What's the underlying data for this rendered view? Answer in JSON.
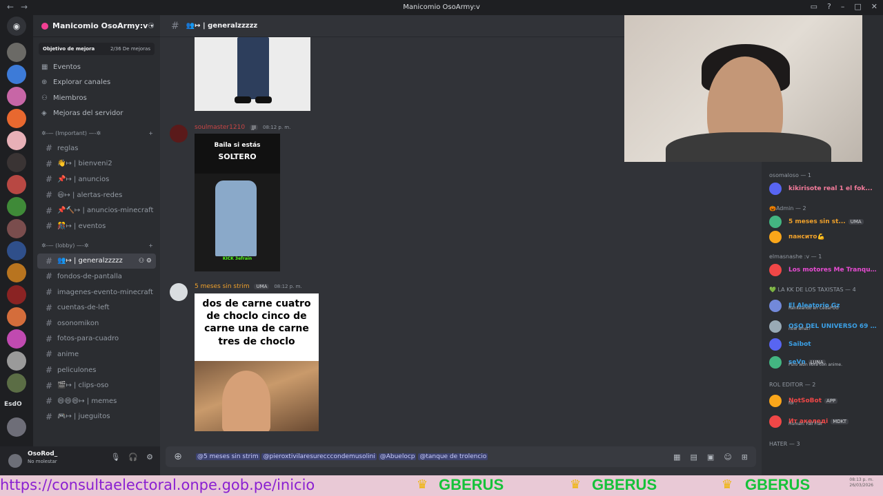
{
  "window": {
    "title": "Manicomio OsoArmy:v"
  },
  "server": {
    "name": "Manicomio OsoArmy:v",
    "boost_goal": {
      "label": "Objetivo de mejora",
      "progress": "2/36 De mejoras"
    },
    "menu": [
      {
        "label": "Eventos",
        "icon": "calendar-icon"
      },
      {
        "label": "Explorar canales",
        "icon": "compass-icon"
      },
      {
        "label": "Miembros",
        "icon": "members-icon"
      },
      {
        "label": "Mejoras del servidor",
        "icon": "boost-icon"
      }
    ],
    "category_important": "✲-— (Important) —-✲",
    "category_lobby": "✲-— (lobby) —-✲",
    "channels_important": [
      "reglas",
      "👋↦ | bienveni2",
      "📌↦ | anuncios",
      "😃↦ | alertas-redes",
      "📌🔨↦ | anuncios-minecraft",
      "🎊↦ | eventos"
    ],
    "active_channel": "👥↦ | generalzzzzz",
    "channels_lobby": [
      "fondos-de-pantalla",
      "imagenes-evento-minecraft",
      "cuentas-de-left",
      "osonomikon",
      "fotos-para-cuadro",
      "anime",
      "peliculones",
      "🎬↦ | clips-oso",
      "😄😄😄↦ | memes",
      "🎮↦ | jueguitos"
    ]
  },
  "user": {
    "name": "OsoRod_",
    "status": "No molestar"
  },
  "header": {
    "channel": "👥↦ | generalzzzzz"
  },
  "messages": [
    {
      "author": "soulmaster1210",
      "badge": "JJI",
      "time": "08:12 p. m.",
      "image_text_top": "Baila si estás",
      "image_text_main": "SOLTERO",
      "image_text_bottom": "KICK 3efrain"
    },
    {
      "author": "5 meses sin strim",
      "badge": "UMA",
      "time": "08:12 p. m.",
      "image_text": "dos de carne cuatro de choclo cinco de carne una de carne tres de choclo"
    }
  ],
  "composer": {
    "mentions": [
      "@5 meses sin strim",
      "@pieroxtivilaresurecccondemusolini",
      "@Abuelocp",
      "@tanque de trolencio"
    ]
  },
  "members": {
    "groups": [
      {
        "title": "osomaloso — 1",
        "members": [
          {
            "name": "kikirisote real 1 el fok...",
            "color": "#f47b9b"
          }
        ]
      },
      {
        "title": "🎃Admin — 2",
        "members": [
          {
            "name": "5 meses sin st...",
            "badge": "UMA",
            "color": "#f0a12b"
          },
          {
            "name": "пансито💪",
            "color": "#f0a12b"
          }
        ]
      },
      {
        "title": "elmasnashe :v — 1",
        "members": [
          {
            "name": "Los motores Me Tranquili...",
            "color": "#e84cd3"
          }
        ]
      },
      {
        "title": "💚 LA KK DE LOS TAXISTAS — 4",
        "members": [
          {
            "name": "El Aleatorio Gz",
            "sub": "Rankeando en CedaPUG",
            "color": "#3ba0e6"
          },
          {
            "name": "OSO DEL UNIVERSO 69 C...",
            "sub": "now what?",
            "color": "#3ba0e6"
          },
          {
            "name": "Saibot",
            "color": "#3ba0e6"
          },
          {
            "name": "seVn",
            "badge": "LUNA",
            "sub": "Puro wbn llora con anime.",
            "color": "#3ba0e6"
          }
        ]
      },
      {
        "title": "ROL EDITOR — 2",
        "members": [
          {
            "name": "NotSoBot",
            "badge": "APP",
            "sub": "for .",
            "color": "#f04747"
          },
          {
            "name": "Ит акеледі",
            "badge": "MDKT",
            "sub": "Human: Fall Flat",
            "color": "#f04747"
          }
        ]
      },
      {
        "title": "HATER — 3",
        "members": []
      }
    ]
  },
  "banner": {
    "url": "https://consultaelectoral.onpe.gob.pe/inicio",
    "brand": "GBERUS",
    "time": "08:13 p. m.",
    "date": "26/03/2026"
  }
}
